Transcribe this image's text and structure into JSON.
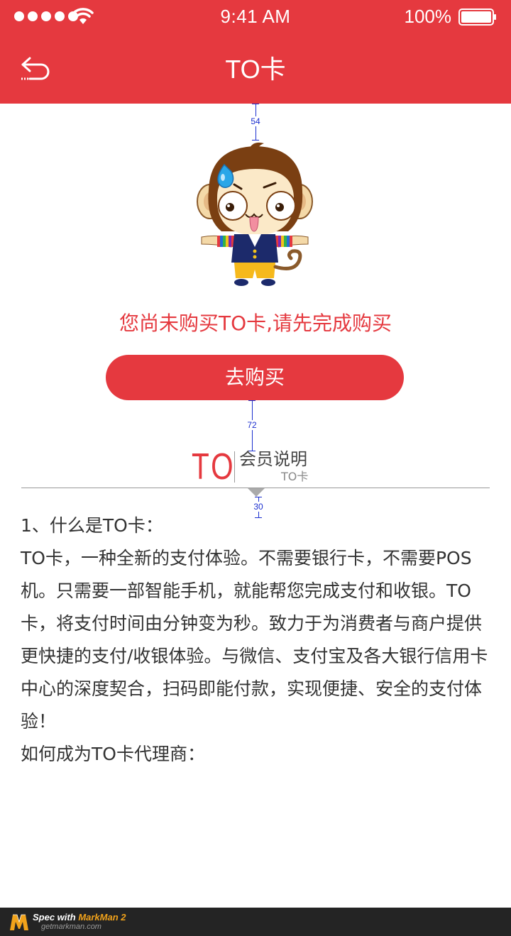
{
  "status_bar": {
    "time": "9:41 AM",
    "battery": "100%"
  },
  "nav": {
    "title": "TO卡",
    "back_icon": "back-arrow-icon"
  },
  "annotations": {
    "top_spacing": "54",
    "button_spacing": "72",
    "content_spacing": "30"
  },
  "empty_state": {
    "mascot": "monkey-mascot-illustration",
    "message": "您尚未购买TO卡,请先完成购买",
    "buy_button": "去购买"
  },
  "section": {
    "logo_mark": "TO",
    "title": "会员说明",
    "subtitle": "TO卡"
  },
  "content": {
    "paragraphs": [
      "1、什么是TO卡：",
      "TO卡，一种全新的支付体验。不需要银行卡，不需要POS机。只需要一部智能手机，就能帮您完成支付和收银。TO卡，将支付时间由分钟变为秒。致力于为消费者与商户提供更快捷的支付/收银体验。与微信、支付宝及各大银行信用卡中心的深度契合，扫码即能付款，实现便捷、安全的支付体验！",
      "如何成为TO卡代理商："
    ]
  },
  "footer": {
    "spec_label": "Spec with",
    "brand": "MarkMan 2",
    "url": "getmarkman.com"
  },
  "colors": {
    "accent": "#e5393f",
    "annotation": "#1b2fcf",
    "footer_bg": "#242424",
    "footer_brand": "#f2a31b"
  }
}
